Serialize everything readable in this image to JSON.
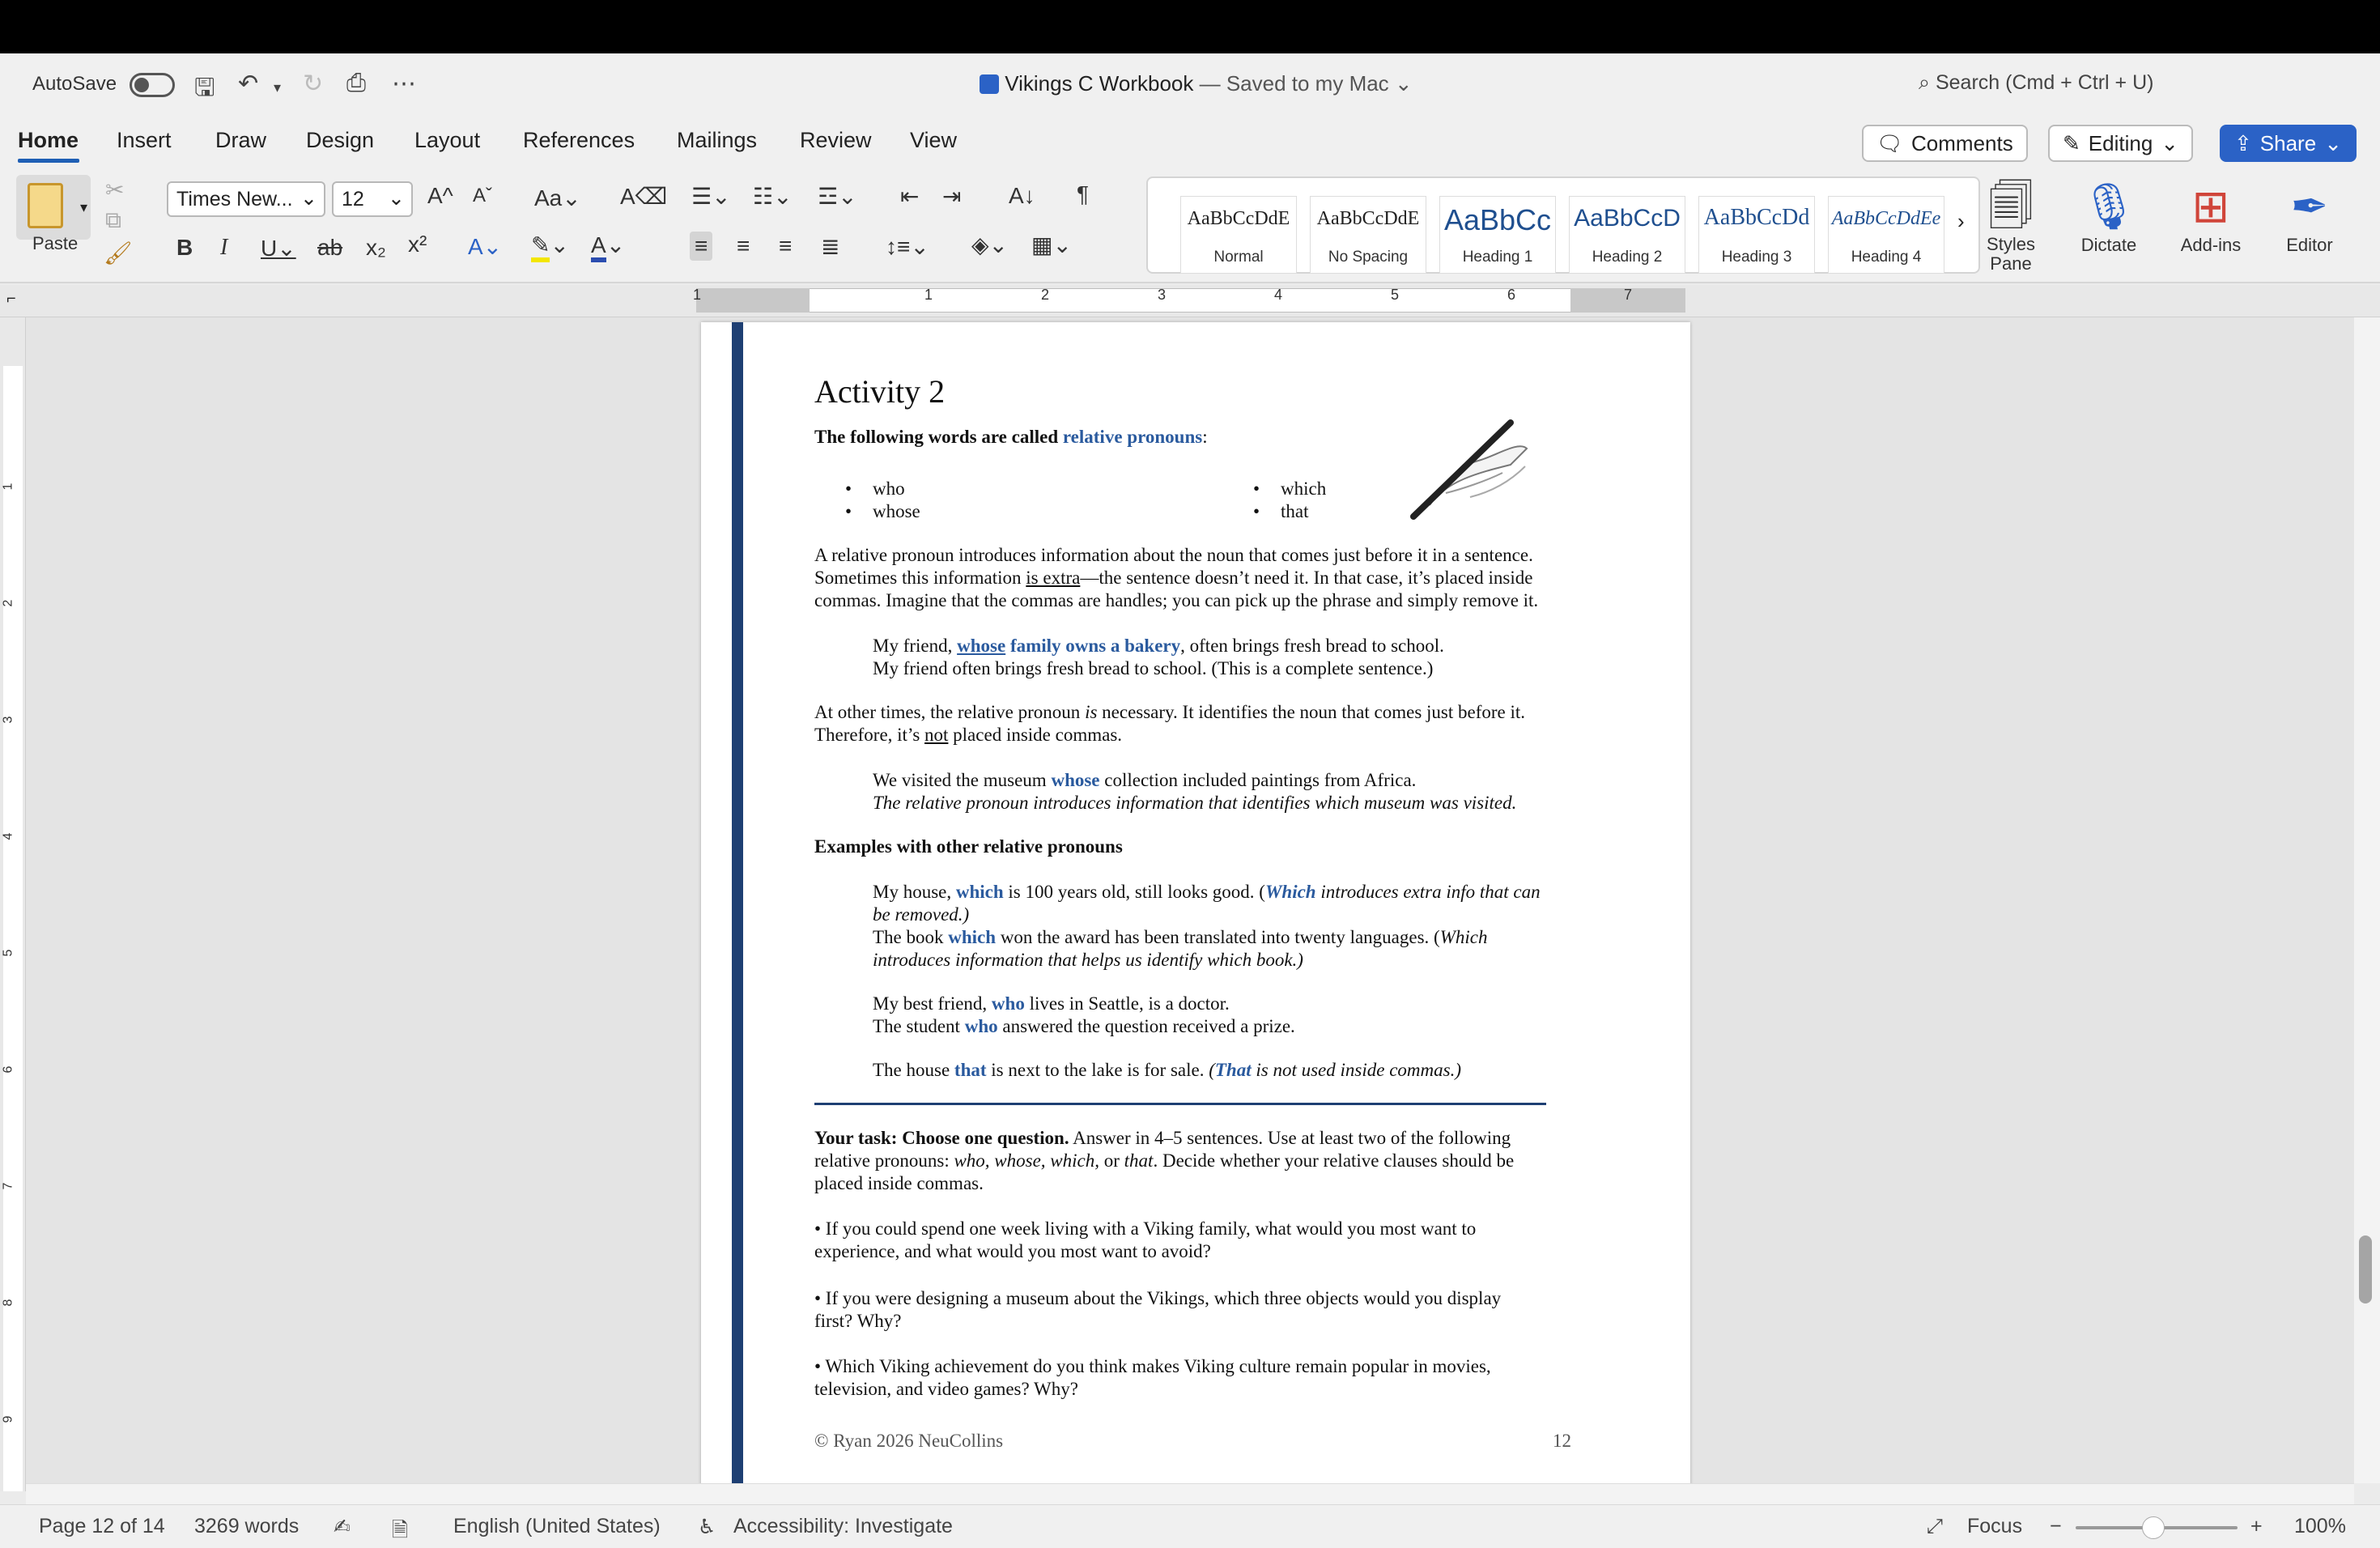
{
  "titlebar": {
    "autosave_label": "AutoSave",
    "doc_name": "Vikings C Workbook",
    "doc_status": "— Saved to my Mac",
    "search_placeholder": "Search (Cmd + Ctrl + U)"
  },
  "tabs": [
    {
      "label": "Home",
      "active": true
    },
    {
      "label": "Insert"
    },
    {
      "label": "Draw"
    },
    {
      "label": "Design"
    },
    {
      "label": "Layout"
    },
    {
      "label": "References"
    },
    {
      "label": "Mailings"
    },
    {
      "label": "Review"
    },
    {
      "label": "View"
    }
  ],
  "header_buttons": {
    "comments": "Comments",
    "editing": "Editing",
    "share": "Share"
  },
  "ribbon": {
    "paste_label": "Paste",
    "font_name": "Times New...",
    "font_size": "12",
    "styles": [
      {
        "preview": "AaBbCcDdE",
        "name": "Normal"
      },
      {
        "preview": "AaBbCcDdE",
        "name": "No Spacing"
      },
      {
        "preview": "AaBbCc",
        "name": "Heading 1"
      },
      {
        "preview": "AaBbCcD",
        "name": "Heading 2"
      },
      {
        "preview": "AaBbCcDd",
        "name": "Heading 3"
      },
      {
        "preview": "AaBbCcDdEe",
        "name": "Heading 4"
      }
    ],
    "styles_pane": "Styles Pane",
    "dictate": "Dictate",
    "addins": "Add-ins",
    "editor": "Editor"
  },
  "ruler_numbers": [
    "1",
    "1",
    "2",
    "3",
    "4",
    "5",
    "6",
    "7"
  ],
  "vruler_numbers": [
    "1",
    "2",
    "3",
    "4",
    "5",
    "6",
    "7",
    "8",
    "9"
  ],
  "document": {
    "title": "Activity 2",
    "intro_prefix": "The following words are called ",
    "intro_term": "relative pronouns",
    "intro_suffix": ":",
    "pronouns": [
      "who",
      "whose",
      "which",
      "that"
    ],
    "p1_line1": "A relative pronoun introduces information about the noun that comes just before it in a sentence.",
    "p1_line2a": "Sometimes this information ",
    "p1_line2u": "is extra",
    "p1_line2b": "—the sentence doesn’t need it. In that case, it’s placed inside",
    "p1_line3": "commas. Imagine that the commas are handles; you can pick up the phrase and simply remove it.",
    "ex1_a": "My friend, ",
    "ex1_whose": "whose",
    "ex1_rest": " family owns a bakery",
    "ex1_b": ", often brings fresh bread to school.",
    "ex1_line2": "My friend often brings fresh bread to school. (This is a complete sentence.)",
    "p2_line1a": "At other times, the relative pronoun ",
    "p2_line1i": "is",
    "p2_line1b": " necessary. It identifies the noun that comes just before it.",
    "p2_line2a": "Therefore, it’s ",
    "p2_line2u": "not",
    "p2_line2b": " placed inside commas.",
    "ex2_a": "We visited the museum ",
    "ex2_whose": "whose",
    "ex2_b": " collection included paintings from Africa.",
    "ex2_line2": "The relative pronoun introduces information that identifies which museum was visited.",
    "examples_heading": "Examples with other relative pronouns",
    "ex3_a": "My house, ",
    "ex3_which": "which",
    "ex3_b": " is 100 years old, still looks good. (",
    "ex3_which2": "Which",
    "ex3_c": " introduces extra info that can",
    "ex3_line2": "be removed.)",
    "ex4_a": "The book ",
    "ex4_which": "which",
    "ex4_b": " won the award has been translated into twenty languages. (",
    "ex4_c": "Which",
    "ex4_line2": "introduces information that helps us identify which book.)",
    "ex5_a": "My best friend, ",
    "ex5_who": "who",
    "ex5_b": " lives in Seattle, is a doctor.",
    "ex6_a": "The student ",
    "ex6_who": "who",
    "ex6_b": " answered the question received a prize.",
    "ex7_a": "The house ",
    "ex7_that": "that",
    "ex7_b": " is next to the lake is for sale. ",
    "ex7_c": "(",
    "ex7_that2": "That",
    "ex7_d": " is not used inside commas.)",
    "task_bold": "Your task: Choose one question.",
    "task_line1": " Answer in 4–5 sentences. Use at least two of the following",
    "task_line2a": "relative pronouns: ",
    "task_line2i": "who, whose, which,",
    "task_line2b": " or ",
    "task_line2i2": "that",
    "task_line2c": ". Decide whether your relative clauses should be",
    "task_line3": "placed inside commas.",
    "q1_line1": "• If you could spend one week living with a Viking family, what would you most want to",
    "q1_line2": "experience, and what would you most want to avoid?",
    "q2_line1": "• If you were designing a museum about the Vikings, which three objects would you display",
    "q2_line2": "first? Why?",
    "q3_line1": "• Which Viking achievement do you think makes Viking culture remain popular in movies,",
    "q3_line2": "television, and video games? Why?",
    "footer_left": "© Ryan 2026 NeuCollins",
    "footer_right": "12"
  },
  "statusbar": {
    "page": "Page 12 of 14",
    "words": "3269 words",
    "language": "English (United States)",
    "accessibility": "Accessibility: Investigate",
    "focus": "Focus",
    "zoom": "100%"
  },
  "colors": {
    "accent": "#2b62c6",
    "doc_blue": "#2a5a9e",
    "page_bar": "#1e3f73"
  }
}
